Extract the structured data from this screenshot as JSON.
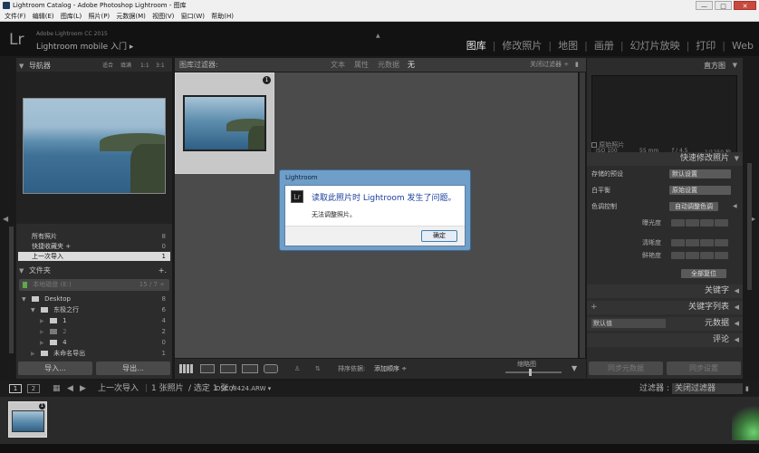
{
  "window": {
    "title": "Lightroom Catalog - Adobe Photoshop Lightroom - 图库",
    "controls": {
      "minimize": "—",
      "maximize": "□",
      "close": "✕"
    }
  },
  "menu": [
    "文件(F)",
    "编辑(E)",
    "图库(L)",
    "照片(P)",
    "元数据(M)",
    "视图(V)",
    "窗口(W)",
    "帮助(H)"
  ],
  "identity": {
    "logo": "Lr",
    "app_name": "Adobe Lightroom CC 2015",
    "mobile": "Lightroom mobile 入门 ▸"
  },
  "modules": [
    "图库",
    "修改照片",
    "地图",
    "画册",
    "幻灯片放映",
    "打印",
    "Web"
  ],
  "left_panel": {
    "navigator": {
      "title": "导航器",
      "zoom": [
        "适合",
        "填满",
        "1:1",
        "3:1 ÷"
      ]
    },
    "catalog": [
      {
        "label": "所有照片",
        "count": "8"
      },
      {
        "label": "快捷收藏夹 +",
        "count": "0"
      },
      {
        "label": "上一次导入",
        "count": "1"
      }
    ],
    "folders": {
      "title": "文件夹",
      "add": "+.",
      "volume": {
        "name": "本地磁盘 (E:)",
        "info": "15 / 7 ÷"
      },
      "items": [
        {
          "label": "Desktop",
          "count": "8"
        },
        {
          "label": "东极之行",
          "count": "6"
        },
        {
          "label": "1",
          "count": "4"
        },
        {
          "label": "2",
          "count": "2"
        },
        {
          "label": "4",
          "count": "0"
        },
        {
          "label": "未命名导出",
          "count": "1"
        }
      ]
    },
    "buttons": {
      "import": "导入...",
      "export": "导出..."
    }
  },
  "filter_bar": {
    "title": "图库过滤器:",
    "options": [
      "文本",
      "属性",
      "元数据",
      "无"
    ],
    "filter_off": "关闭过滤器 ÷"
  },
  "grid": {
    "badge": "1"
  },
  "dialog": {
    "title": "Lightroom",
    "icon": "Lr",
    "message": "读取此照片时 Lightroom 发生了问题。",
    "sub": "无法调整照片。",
    "ok": "确定"
  },
  "toolbar": {
    "sort_label": "排序依据:",
    "sort_value": "添加顺序 ÷",
    "thumb_label": "缩略图"
  },
  "right_panel": {
    "histogram": {
      "title": "直方图",
      "iso": "ISO 100",
      "focal": "55 mm",
      "aperture": "f / 4.5",
      "shutter": "1/1250 秒",
      "original": "原始照片"
    },
    "quick_develop": {
      "title": "快速修改照片",
      "preset_label": "存储的预设",
      "preset_value": "默认设置",
      "wb_label": "白平衡",
      "wb_value": "原始设置",
      "tone_label": "色调控制",
      "auto_tone": "自动调整色调",
      "exposure": "曝光度",
      "clarity": "清晰度",
      "vibrance": "鲜艳度",
      "reset": "全部复位"
    },
    "keywording": "关键字",
    "keyword_list": "关键字列表",
    "metadata_preset": "默认值",
    "metadata": "元数据",
    "comments": "评论",
    "sync_metadata": "同步元数据",
    "sync_settings": "同步设置"
  },
  "filmstrip_bar": {
    "pages": [
      "1",
      "2"
    ],
    "source": "上一次导入",
    "count": "1 张照片",
    "selected": "/ 选定 1 张 /",
    "filename": "DSC08424.ARW ▾",
    "filter_label": "过滤器 :",
    "filter_value": "关闭过滤器"
  },
  "filmstrip": {
    "badge": "1"
  }
}
